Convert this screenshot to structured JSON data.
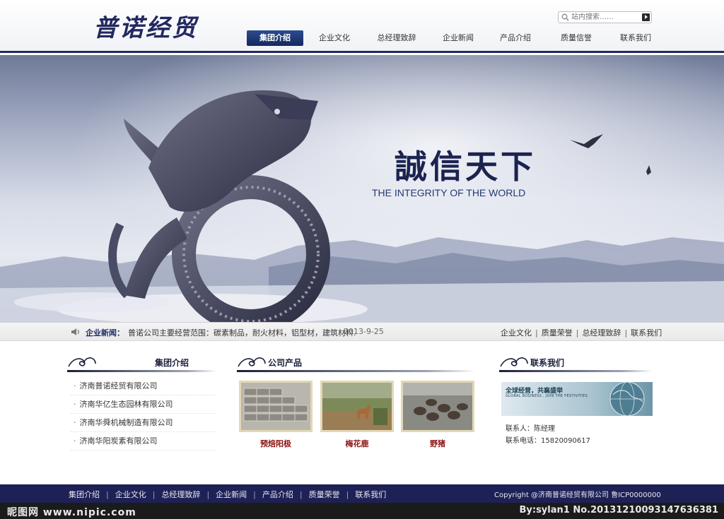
{
  "header": {
    "logo_text": "普诺经贸",
    "search_placeholder": "站内搜索……",
    "nav": [
      "集团介绍",
      "企业文化",
      "总经理致辞",
      "企业新闻",
      "产品介绍",
      "质量信誉",
      "联系我们"
    ]
  },
  "banner": {
    "slogan_cn": "誠信天下",
    "slogan_en": "THE INTEGRITY OF THE WORLD"
  },
  "newsbar": {
    "label": "企业新闻：",
    "headline": "普诺公司主要经营范围：碳素制品，耐火材料，铝型材，建筑材料.",
    "date": "2013-9-25",
    "quick_links": [
      "企业文化",
      "质量荣誉",
      "总经理致辞",
      "联系我们"
    ]
  },
  "group_section": {
    "title": "集团介绍",
    "items": [
      "济南普诺经贸有限公司",
      "济南华亿生态园林有限公司",
      "济南华舜机械制造有限公司",
      "济南华阳炭素有限公司"
    ]
  },
  "product_section": {
    "title": "公司产品",
    "items": [
      "预焙阳极",
      "梅花鹿",
      "野猪"
    ]
  },
  "contact_section": {
    "title": "联系我们",
    "ad_cn": "全球经营，共襄盛举",
    "ad_en": "GLOBAL BUSINESS , JOIN THE FESTIVITIES",
    "contact_person": "联系人：陈经理",
    "phone": "联系电话：15820090617"
  },
  "footer": {
    "nav": [
      "集团介绍",
      "企业文化",
      "总经理致辞",
      "企业新闻",
      "产品介绍",
      "质量荣誉",
      "联系我们"
    ],
    "copyright": "Copyright @济南普诺经贸有限公司 鲁ICP0000000"
  },
  "watermark": {
    "left": "昵图网 www.nipic.com",
    "right": "By:sylan1  No.20131210093147636381"
  },
  "colors": {
    "navy": "#1f2a63",
    "footer": "#1d2156",
    "product_name": "#8b1313"
  }
}
